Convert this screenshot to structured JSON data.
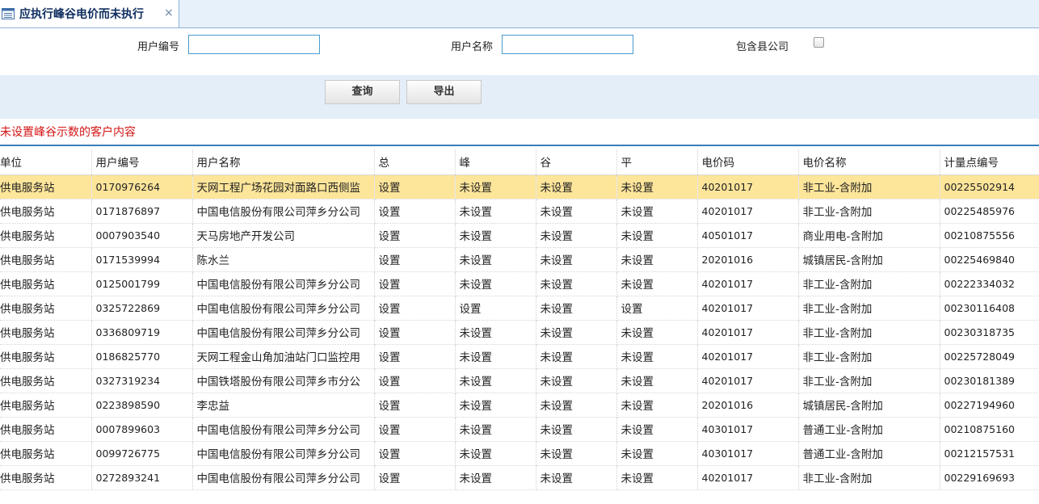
{
  "tab": {
    "title": "应执行峰谷电价而未执行",
    "close": "×"
  },
  "filters": {
    "user_no_label": "用户编号",
    "user_name_label": "用户名称",
    "include_county_label": "包含县公司",
    "user_no_value": "",
    "user_name_value": ""
  },
  "buttons": {
    "query": "查询",
    "export": "导出"
  },
  "section_title": "未设置峰谷示数的客户内容",
  "table": {
    "headers": [
      "单位",
      "用户编号",
      "用户名称",
      "总",
      "峰",
      "谷",
      "平",
      "电价码",
      "电价名称",
      "计量点编号"
    ],
    "rows": [
      [
        "供电服务站",
        "0170976264",
        "天网工程广场花园对面路口西侧监",
        "设置",
        "未设置",
        "未设置",
        "未设置",
        "40201017",
        "非工业-含附加",
        "00225502914"
      ],
      [
        "供电服务站",
        "0171876897",
        "中国电信股份有限公司萍乡分公司",
        "设置",
        "未设置",
        "未设置",
        "未设置",
        "40201017",
        "非工业-含附加",
        "00225485976"
      ],
      [
        "供电服务站",
        "0007903540",
        "天马房地产开发公司",
        "设置",
        "未设置",
        "未设置",
        "未设置",
        "40501017",
        "商业用电-含附加",
        "00210875556"
      ],
      [
        "供电服务站",
        "0171539994",
        "陈水兰",
        "设置",
        "未设置",
        "未设置",
        "未设置",
        "20201016",
        "城镇居民-含附加",
        "00225469840"
      ],
      [
        "供电服务站",
        "0125001799",
        "中国电信股份有限公司萍乡分公司",
        "设置",
        "未设置",
        "未设置",
        "未设置",
        "40201017",
        "非工业-含附加",
        "00222334032"
      ],
      [
        "供电服务站",
        "0325722869",
        "中国电信股份有限公司萍乡分公司",
        "设置",
        "设置",
        "未设置",
        "设置",
        "40201017",
        "非工业-含附加",
        "00230116408"
      ],
      [
        "供电服务站",
        "0336809719",
        "中国电信股份有限公司萍乡分公司",
        "设置",
        "未设置",
        "未设置",
        "未设置",
        "40201017",
        "非工业-含附加",
        "00230318735"
      ],
      [
        "供电服务站",
        "0186825770",
        "天网工程金山角加油站门口监控用",
        "设置",
        "未设置",
        "未设置",
        "未设置",
        "40201017",
        "非工业-含附加",
        "00225728049"
      ],
      [
        "供电服务站",
        "0327319234",
        "中国铁塔股份有限公司萍乡市分公",
        "设置",
        "未设置",
        "未设置",
        "未设置",
        "40201017",
        "非工业-含附加",
        "00230181389"
      ],
      [
        "供电服务站",
        "0223898590",
        "李忠益",
        "设置",
        "未设置",
        "未设置",
        "未设置",
        "20201016",
        "城镇居民-含附加",
        "00227194960"
      ],
      [
        "供电服务站",
        "0007899603",
        "中国电信股份有限公司萍乡分公司",
        "设置",
        "未设置",
        "未设置",
        "未设置",
        "40301017",
        "普通工业-含附加",
        "00210875160"
      ],
      [
        "供电服务站",
        "0099726775",
        "中国电信股份有限公司萍乡分公司",
        "设置",
        "未设置",
        "未设置",
        "未设置",
        "40301017",
        "普通工业-含附加",
        "00212157531"
      ],
      [
        "供电服务站",
        "0272893241",
        "中国电信股份有限公司萍乡分公司",
        "设置",
        "未设置",
        "未设置",
        "未设置",
        "40201017",
        "非工业-含附加",
        "00229169693"
      ]
    ]
  },
  "colors": {
    "selected_row": "#fde59a",
    "section_title": "#d31515",
    "tab_bar": "#e7f1fa",
    "button_bar": "#e3eef8"
  }
}
